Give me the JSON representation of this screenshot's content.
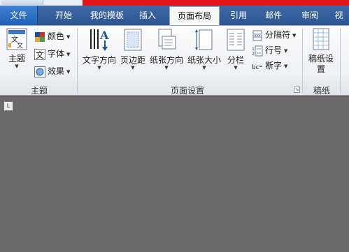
{
  "tabs": [
    {
      "label": "文件"
    },
    {
      "label": "开始"
    },
    {
      "label": "我的模板"
    },
    {
      "label": "插入"
    },
    {
      "label": "页面布局"
    },
    {
      "label": "引用"
    },
    {
      "label": "邮件"
    },
    {
      "label": "审阅"
    },
    {
      "label": "视"
    }
  ],
  "active_tab": "页面布局",
  "ribbon": {
    "theme_group": {
      "label": "主题",
      "theme_button": "主题",
      "colors": "颜色",
      "fonts": "字体",
      "effects": "效果"
    },
    "page_setup_group": {
      "label": "页面设置",
      "text_direction": "文字方向",
      "margins": "页边距",
      "orientation": "纸张方向",
      "size": "纸张大小",
      "columns": "分栏",
      "breaks": "分隔符",
      "line_numbers": "行号",
      "hyphenation": "断字"
    },
    "draft_group": {
      "label": "稿纸",
      "draft_setup": "稿纸设置"
    }
  },
  "colors": {
    "tab_bar": "#2c5590",
    "file_tab": "#1f62b6",
    "accent_red": "#e3141b",
    "workspace": "#6a6a6a"
  },
  "ruler_toggle": "L"
}
